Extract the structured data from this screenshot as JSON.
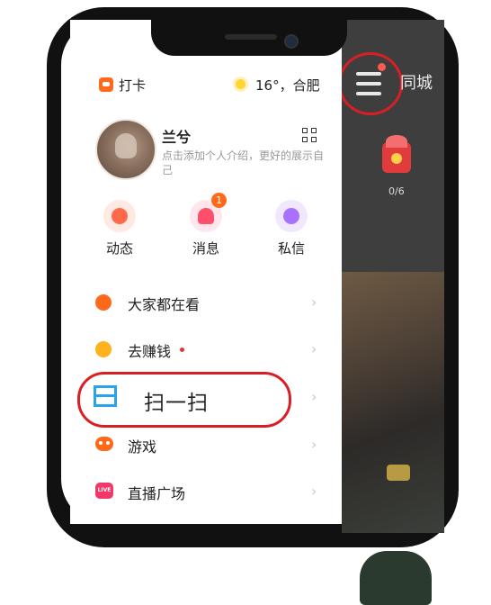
{
  "topbar": {
    "checkin_label": "打卡",
    "weather_text": "16°，合肥"
  },
  "profile": {
    "username": "兰兮",
    "bio": "点击添加个人介绍，更好的展示自己"
  },
  "quick_actions": [
    {
      "label": "动态",
      "icon": "planet-icon",
      "color": "#ff6a4a"
    },
    {
      "label": "消息",
      "icon": "bell-icon",
      "color": "#ff4f6d",
      "badge": "1"
    },
    {
      "label": "私信",
      "icon": "chat-icon",
      "color": "#a971ff"
    }
  ],
  "menu": [
    {
      "label": "大家都在看",
      "icon": "compass-icon",
      "color": "#ff6a1a"
    },
    {
      "label": "去赚钱",
      "icon": "coin-icon",
      "color": "#ffb21f",
      "dot": true
    },
    {
      "label": "扫一扫",
      "icon": "scan-icon",
      "color": "#2aa3e8"
    },
    {
      "label": "游戏",
      "icon": "gamepad-icon",
      "color": "#ff6a1a"
    },
    {
      "label": "直播广场",
      "icon": "live-icon",
      "color": "#f2386a",
      "icon_text": "LIVE"
    }
  ],
  "main_screen": {
    "city_tab": "同城",
    "task_progress": "0/6"
  },
  "annotation_color": "#d81f26"
}
